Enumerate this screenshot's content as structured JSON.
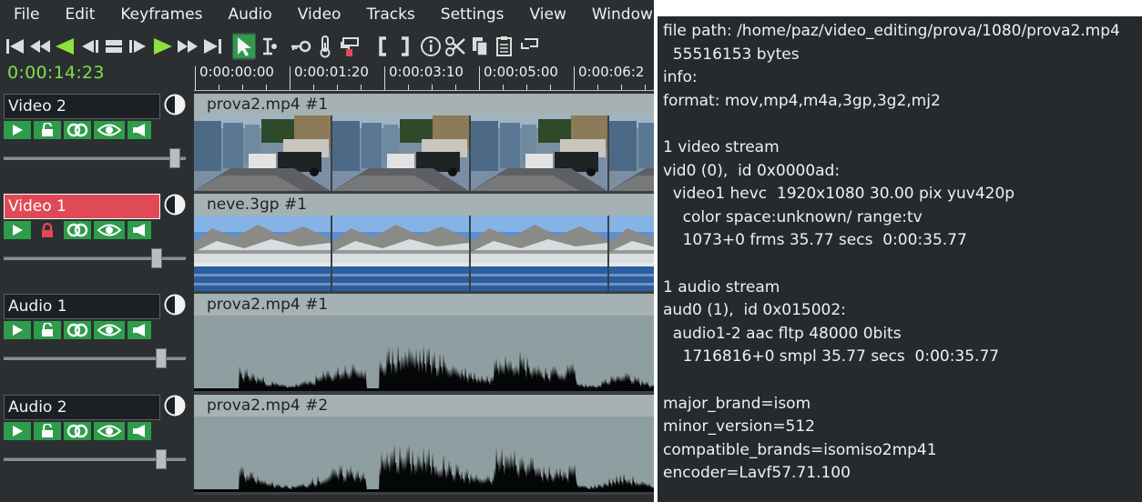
{
  "menu": [
    "File",
    "Edit",
    "Keyframes",
    "Audio",
    "Video",
    "Tracks",
    "Settings",
    "View",
    "Window"
  ],
  "toolbar_icons": [
    "go-start-icon",
    "rewind-icon",
    "play-reverse-icon",
    "step-back-icon",
    "stop-icon",
    "step-forward-icon",
    "play-icon",
    "fast-forward-icon",
    "go-end-icon",
    "select-arrow-icon",
    "trim-tool-icon",
    "key-icon",
    "thermometer-icon",
    "paint-icon",
    "bracket-left-icon",
    "bracket-right-icon",
    "info-icon",
    "scissors-icon",
    "copy-icon",
    "paste-icon",
    "slice-icon"
  ],
  "timecode": "0:00:14:23",
  "ruler": [
    "0:00:00:00",
    "0:00:01:20",
    "0:00:03:10",
    "0:00:05:00",
    "0:00:06:2"
  ],
  "tracks": [
    {
      "name": "Video 2",
      "selected": false,
      "locked": false,
      "clip": "prova2.mp4 #1",
      "kind": "video-garage",
      "volume": 0.97
    },
    {
      "name": "Video 1",
      "selected": true,
      "locked": true,
      "clip": "neve.3gp #1",
      "kind": "video-snow",
      "volume": 0.86
    },
    {
      "name": "Audio 1",
      "selected": false,
      "locked": false,
      "clip": "prova2.mp4 #1",
      "kind": "audio",
      "volume": 0.89
    },
    {
      "name": "Audio 2",
      "selected": false,
      "locked": false,
      "clip": "prova2.mp4 #2",
      "kind": "audio",
      "volume": 0.89
    }
  ],
  "colors": {
    "accent_green": "#7ee04a",
    "button_green": "#2e9c4a",
    "selected_red": "#e04a57",
    "clip_label": "#a5b1b3"
  },
  "info": [
    "file path: /home/paz/video_editing/prova/1080/prova2.mp4",
    "  55516153 bytes",
    "info:",
    "format: mov,mp4,m4a,3gp,3g2,mj2",
    "",
    "1 video stream",
    "vid0 (0),  id 0x0000ad:",
    "  video1 hevc  1920x1080 30.00 pix yuv420p",
    "    color space:unknown/ range:tv",
    "    1073+0 frms 35.77 secs  0:00:35.77",
    "",
    "1 audio stream",
    "aud0 (1),  id 0x015002:",
    "  audio1-2 aac fltp 48000 0bits",
    "    1716816+0 smpl 35.77 secs  0:00:35.77",
    "",
    "major_brand=isom",
    "minor_version=512",
    "compatible_brands=isomiso2mp41",
    "encoder=Lavf57.71.100"
  ]
}
